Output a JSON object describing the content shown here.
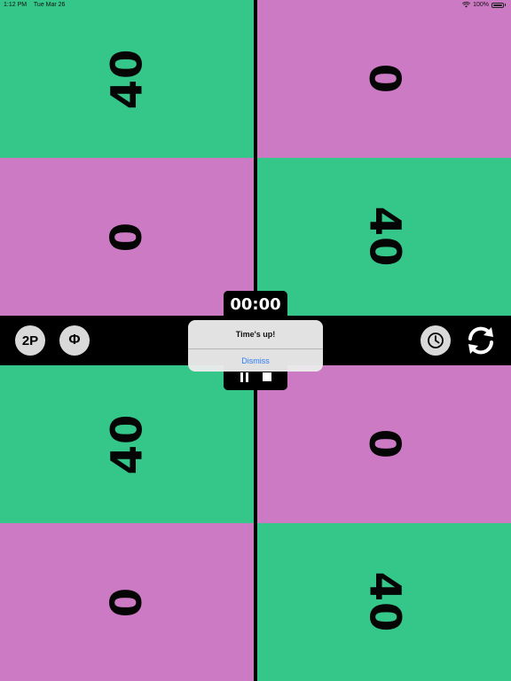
{
  "status_bar": {
    "time": "1:12 PM",
    "date": "Tue Mar 26",
    "battery": "100%"
  },
  "panels": {
    "top_left_upper": "40",
    "top_left_lower": "0",
    "top_right_upper": "0",
    "top_right_lower": "40",
    "bottom_left_upper": "40",
    "bottom_left_lower": "0",
    "bottom_right_upper": "0",
    "bottom_right_lower": "40"
  },
  "toolbar": {
    "two_player_label": "2P",
    "phi_label": "Φ",
    "timer": "00:00",
    "clock_icon": "clock-icon",
    "reset_icon": "refresh-icon"
  },
  "alert": {
    "title": "Time's up!",
    "dismiss_label": "Dismiss"
  },
  "colors": {
    "green": "#35c68a",
    "pink": "#cc7ac4"
  }
}
